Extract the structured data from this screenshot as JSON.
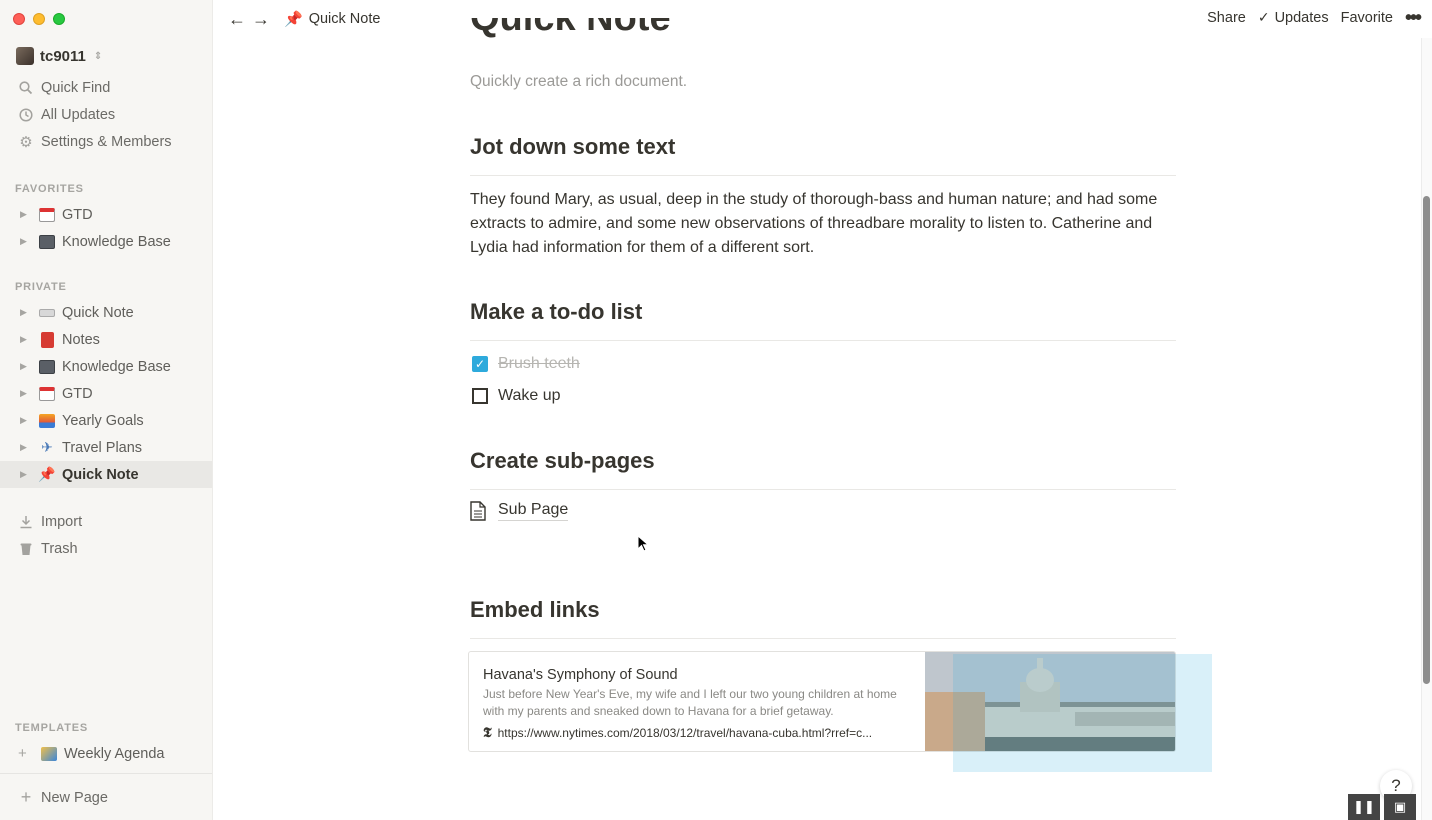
{
  "sidebar": {
    "workspace": "tc9011",
    "nav": [
      {
        "label": "Quick Find",
        "icon": "search-icon"
      },
      {
        "label": "All Updates",
        "icon": "clock-icon"
      },
      {
        "label": "Settings & Members",
        "icon": "gear-icon"
      }
    ],
    "favorites_label": "FAVORITES",
    "favorites": [
      {
        "label": "GTD",
        "icon": "calendar-emoji"
      },
      {
        "label": "Knowledge Base",
        "icon": "cabinet-emoji"
      }
    ],
    "private_label": "PRIVATE",
    "private": [
      {
        "label": "Quick Note",
        "icon": "keyboard-emoji"
      },
      {
        "label": "Notes",
        "icon": "red-book-emoji"
      },
      {
        "label": "Knowledge Base",
        "icon": "cabinet-emoji"
      },
      {
        "label": "GTD",
        "icon": "calendar-emoji"
      },
      {
        "label": "Yearly Goals",
        "icon": "sunrise-emoji"
      },
      {
        "label": "Travel Plans",
        "icon": "airplane-emoji"
      },
      {
        "label": "Quick Note",
        "icon": "pushpin-emoji",
        "active": true
      }
    ],
    "import": "Import",
    "trash": "Trash",
    "templates_label": "TEMPLATES",
    "template_item": "Weekly Agenda",
    "new_page": "New Page"
  },
  "topbar": {
    "breadcrumb": "Quick Note",
    "share": "Share",
    "updates": "Updates",
    "favorite": "Favorite"
  },
  "page": {
    "title": "Quick Note",
    "subtitle": "Quickly create a rich document.",
    "h_text": "Jot down some text",
    "paragraph": "They found Mary, as usual, deep in the study of thorough-bass and human nature; and had some extracts to admire, and some new observations of threadbare morality to listen to. Catherine and Lydia had information for them of a different sort.",
    "h_todo": "Make a to-do list",
    "todos": [
      {
        "label": "Brush teeth",
        "done": true
      },
      {
        "label": "Wake up",
        "done": false
      }
    ],
    "h_sub": "Create sub-pages",
    "subpage": "Sub Page",
    "h_embed": "Embed links",
    "embed": {
      "title": "Havana's Symphony of Sound",
      "description": "Just before New Year's Eve, my wife and I left our two young children at home with my parents and sneaked down to Havana for a brief getaway.",
      "url": "https://www.nytimes.com/2018/03/12/travel/havana-cuba.html?rref=c..."
    }
  },
  "colors": {
    "accent": "#2eaadc",
    "sidebar_bg": "#f7f6f3",
    "text": "#37352f"
  }
}
